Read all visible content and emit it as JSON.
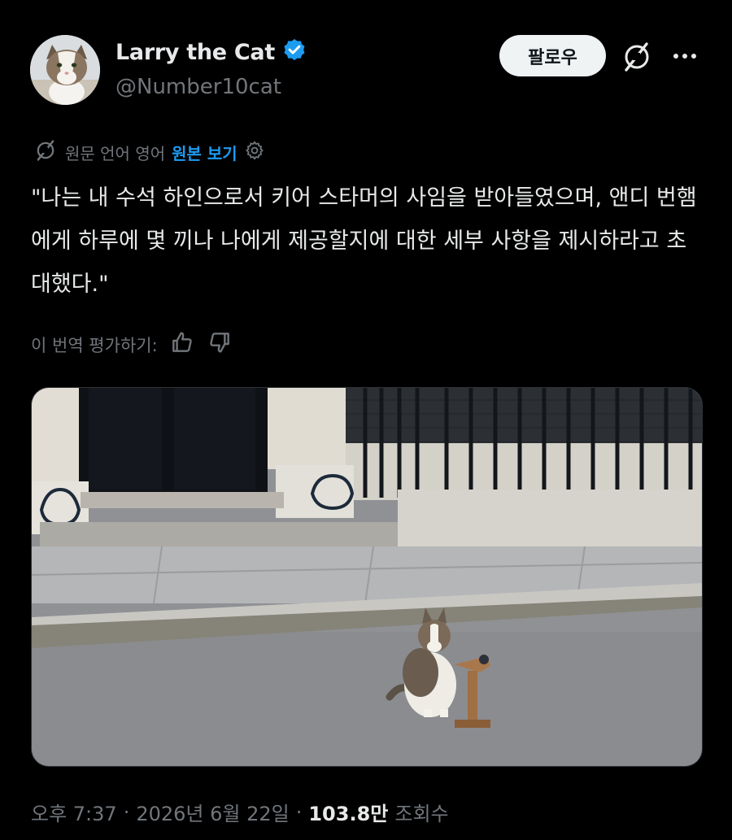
{
  "user": {
    "name": "Larry the Cat",
    "handle": "@Number10cat",
    "verified_color": "#1d9bf0"
  },
  "actions": {
    "follow_label": "팔로우"
  },
  "translation": {
    "source_text": "원문 언어 영어",
    "show_original": "원본 보기",
    "body": "\"나는 내 수석 하인으로서 키어 스타머의 사임을 받아들였으며, 앤디 번햄에게 하루에 몇 끼나 나에게 제공할지에 대한 세부 사항을 제시하라고 초대했다.\"",
    "rate_label": "이 번역 평가하기:"
  },
  "meta": {
    "time": "오후 7:37",
    "date": "2026년 6월 22일",
    "views_count": "103.8만",
    "views_label": "조회수",
    "separator": "·"
  },
  "icons": {
    "grok": "grok-icon",
    "more": "more-icon",
    "settings": "gear-icon",
    "thumbs_up": "thumbs-up-icon",
    "thumbs_down": "thumbs-down-icon"
  }
}
